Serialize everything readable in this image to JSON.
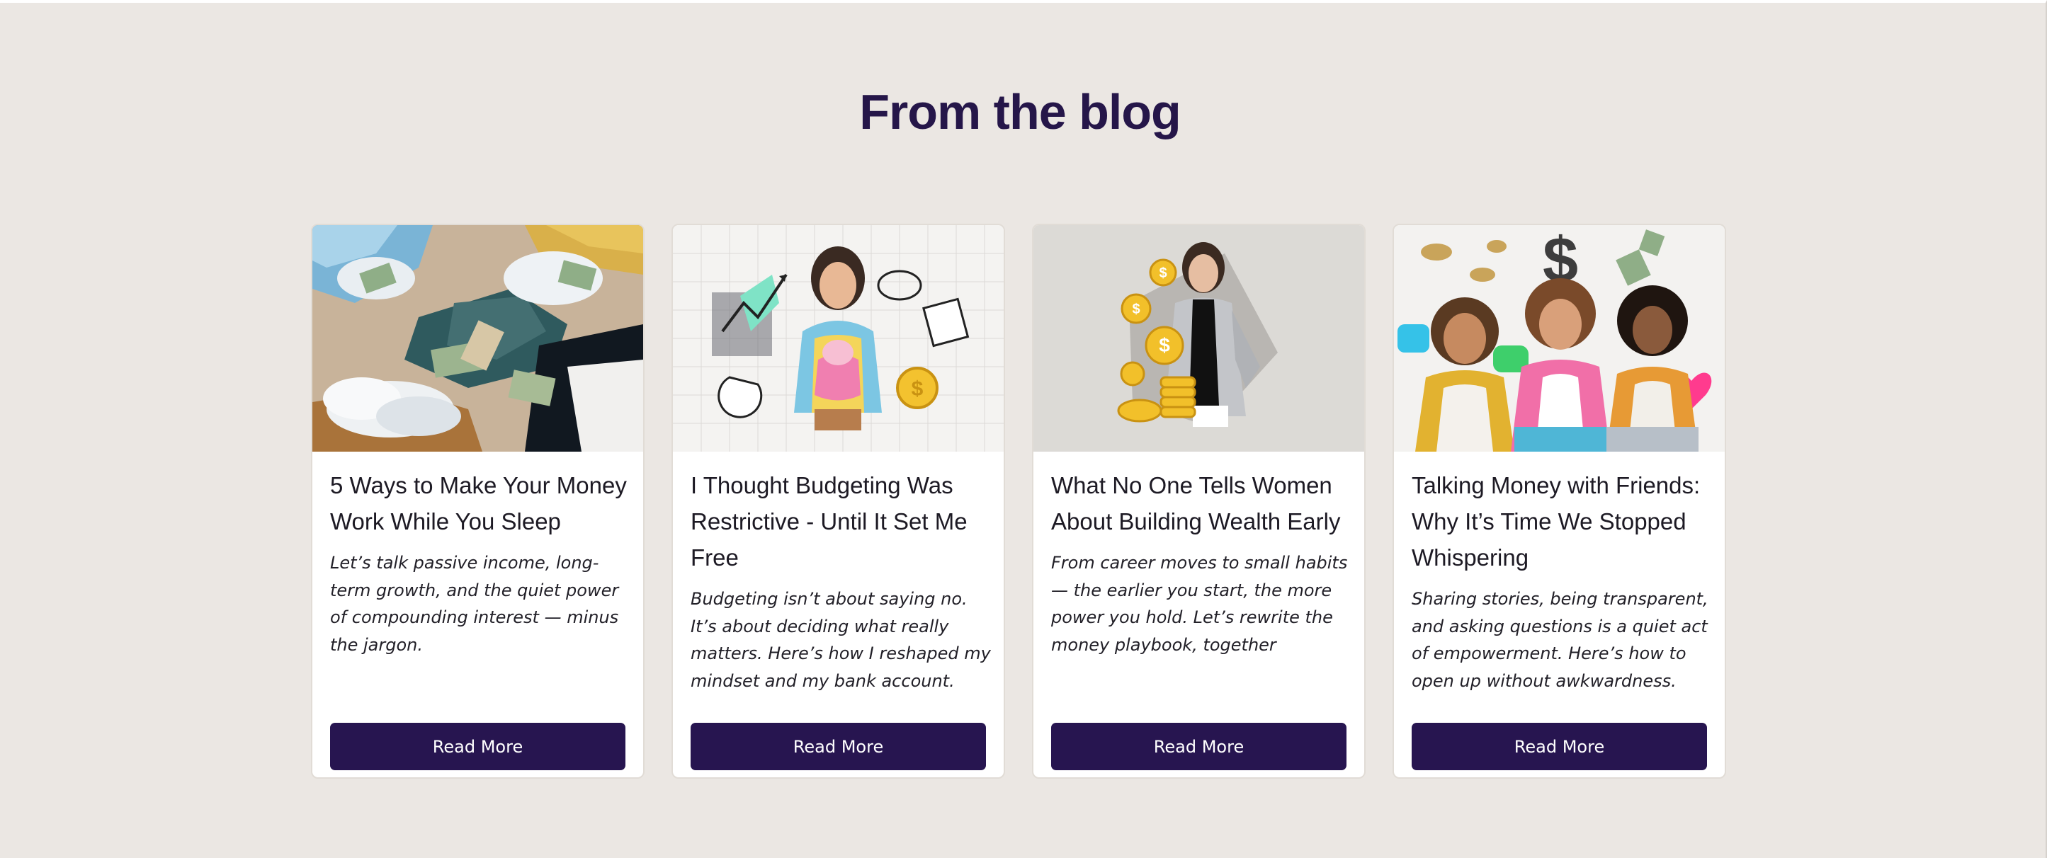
{
  "section": {
    "title": "From the blog"
  },
  "colors": {
    "page_background": "#ebe7e3",
    "card_background": "#ffffff",
    "title_color": "#251649",
    "button_background": "#271550",
    "button_text": "#ffffff"
  },
  "posts": [
    {
      "image": "collage-sleeping-woman-money-clouds",
      "title": "5 Ways to Make Your Money Work While You Sleep",
      "excerpt": "Let’s talk passive income, long-term growth, and the quiet power of compounding interest — minus the jargon.",
      "button_label": "Read More"
    },
    {
      "image": "collage-woman-piggy-bank-charts",
      "title": "I Thought Budgeting Was Restrictive - Until It Set Me Free",
      "excerpt": "Budgeting isn’t about saying no. It’s about deciding what really matters. Here’s how I reshaped my mindset and my bank account.",
      "button_label": "Read More"
    },
    {
      "image": "businesswoman-gold-coins",
      "title": "What No One Tells Women About Building Wealth Early",
      "excerpt": "From career moves to small habits — the earlier you start, the more power you hold. Let’s rewrite the money playbook, together",
      "button_label": "Read More"
    },
    {
      "image": "three-friends-phones-money-icons",
      "title": "Talking Money with Friends: Why It’s Time We Stopped Whispering",
      "excerpt": "Sharing stories, being transparent, and asking questions is a quiet act of empowerment. Here’s how to open up without awkwardness.",
      "button_label": "Read More"
    }
  ]
}
